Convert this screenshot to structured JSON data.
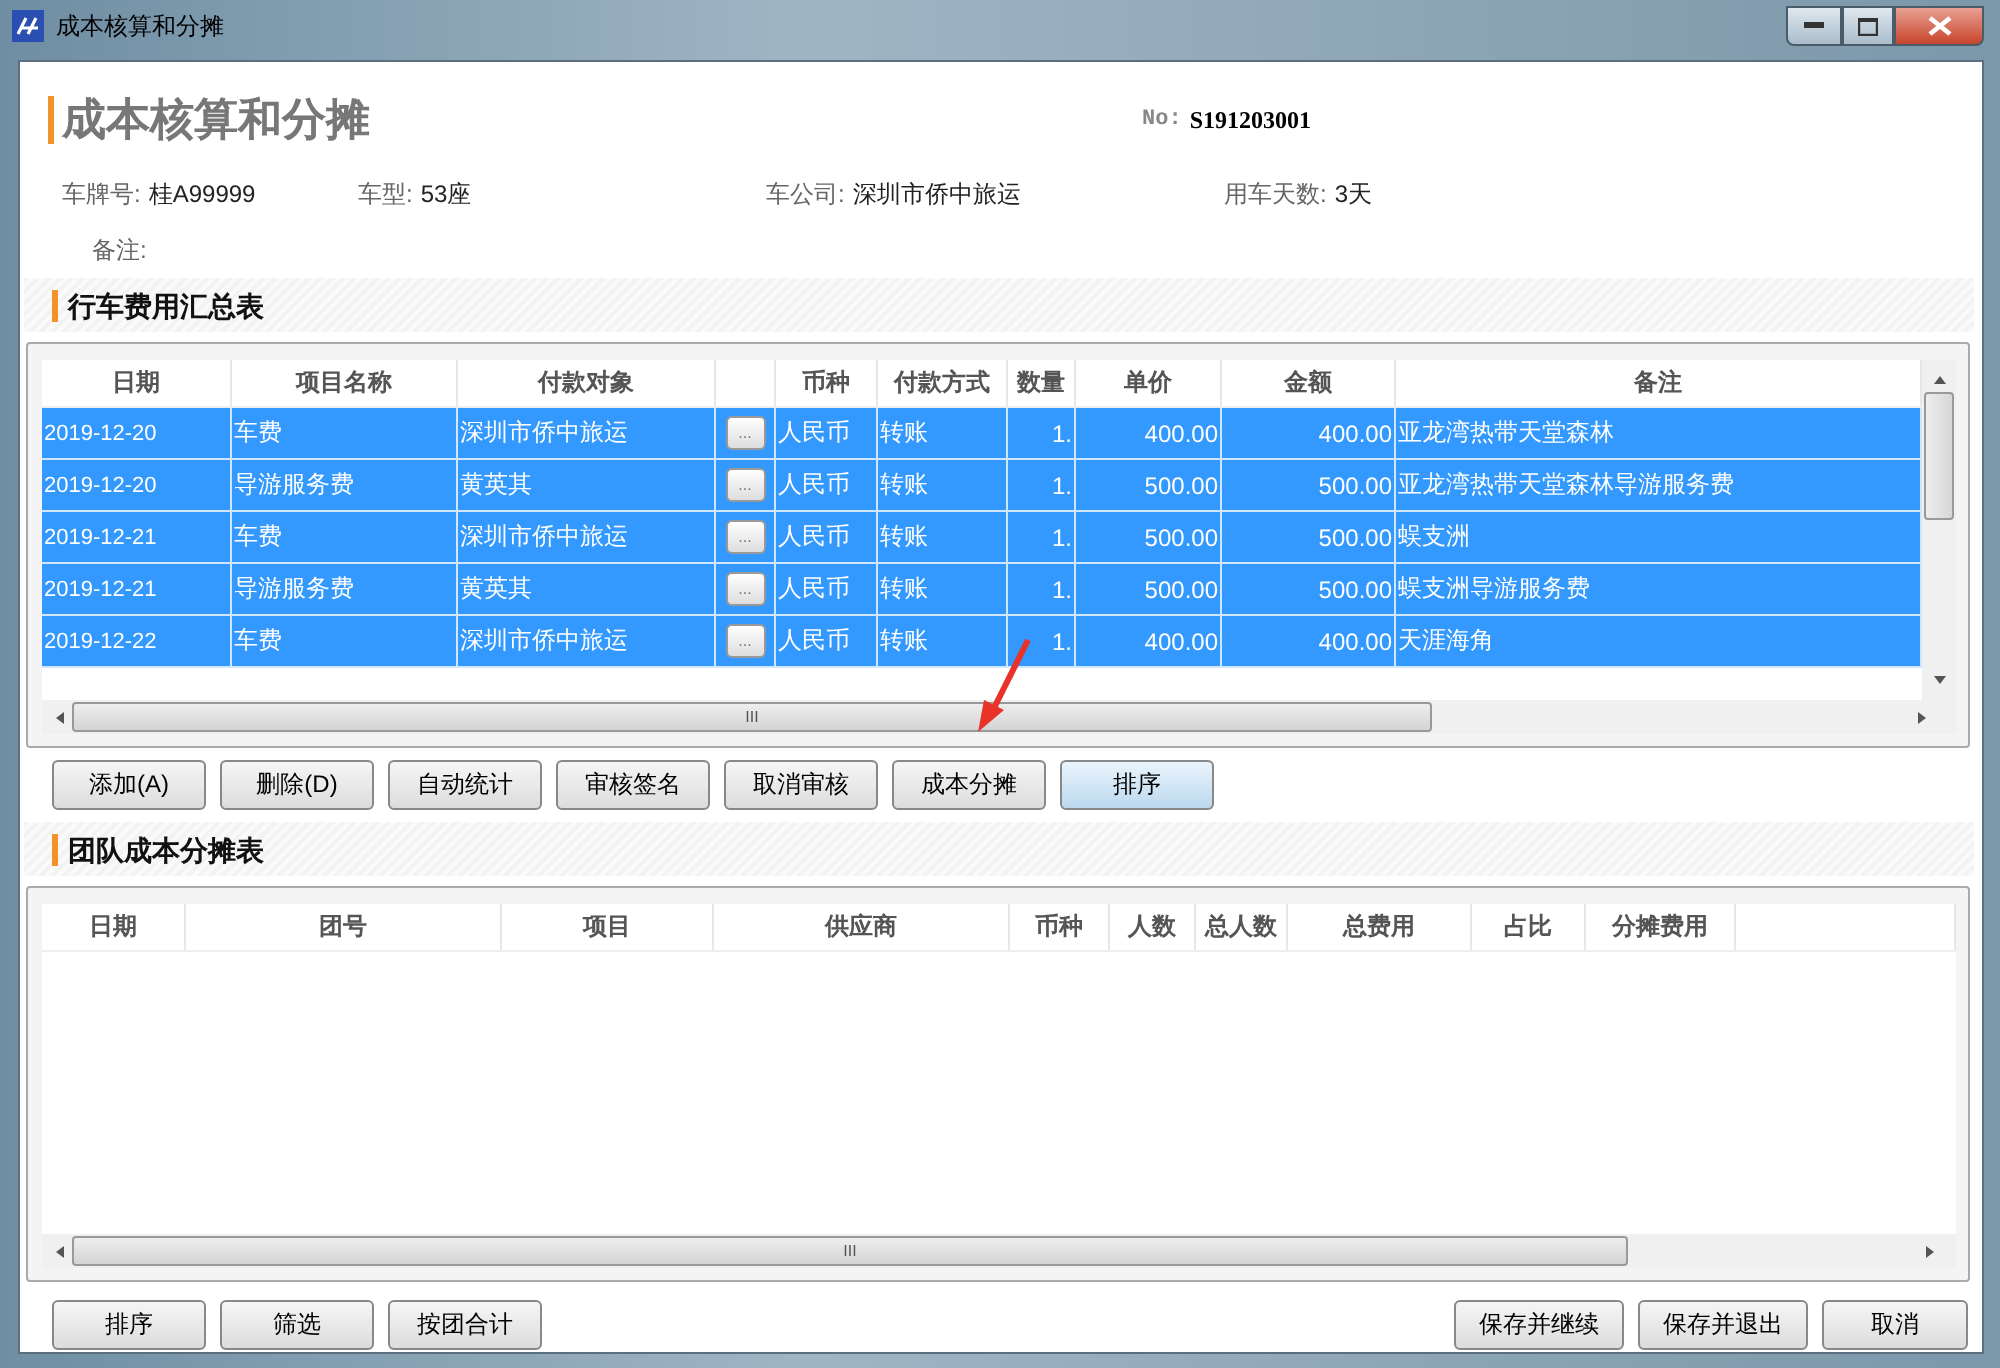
{
  "window": {
    "title": "成本核算和分摊"
  },
  "header": {
    "title": "成本核算和分摊",
    "number_label": "No:",
    "number": "S191203001"
  },
  "info": [
    {
      "label": "车牌号:",
      "value": "桂A99999"
    },
    {
      "label": "车型:",
      "value": "53座"
    },
    {
      "label": "车公司:",
      "value": "深圳市侨中旅运"
    },
    {
      "label": "用车天数:",
      "value": "3天"
    }
  ],
  "notes": {
    "label": "备注:"
  },
  "expense_section": {
    "title": "行车费用汇总表",
    "columns": [
      "日期",
      "项目名称",
      "付款对象",
      "",
      "币种",
      "付款方式",
      "数量",
      "单价",
      "金额",
      "备注"
    ],
    "rows": [
      {
        "selected": true,
        "cells": [
          "2019-12-20",
          "车费",
          "深圳市侨中旅运",
          "...",
          "人民币",
          "转账",
          "1.",
          "400.00",
          "400.00",
          "亚龙湾热带天堂森林"
        ]
      },
      {
        "selected": true,
        "cells": [
          "2019-12-20",
          "导游服务费",
          "黄英其",
          "...",
          "人民币",
          "转账",
          "1.",
          "500.00",
          "500.00",
          "亚龙湾热带天堂森林导游服务费"
        ]
      },
      {
        "selected": true,
        "cells": [
          "2019-12-21",
          "车费",
          "深圳市侨中旅运",
          "...",
          "人民币",
          "转账",
          "1.",
          "500.00",
          "500.00",
          "蜈支洲"
        ]
      },
      {
        "selected": true,
        "cells": [
          "2019-12-21",
          "导游服务费",
          "黄英其",
          "...",
          "人民币",
          "转账",
          "1.",
          "500.00",
          "500.00",
          "蜈支洲导游服务费"
        ]
      },
      {
        "selected": true,
        "cells": [
          "2019-12-22",
          "车费",
          "深圳市侨中旅运",
          "...",
          "人民币",
          "转账",
          "1.",
          "400.00",
          "400.00",
          "天涯海角"
        ]
      }
    ],
    "scroll_mark": "III",
    "buttons": [
      "添加(A)",
      "删除(D)",
      "自动统计",
      "审核签名",
      "取消审核",
      "成本分摊",
      "排序"
    ]
  },
  "allocation_section": {
    "title": "团队成本分摊表",
    "columns": [
      "日期",
      "团号",
      "项目",
      "供应商",
      "币种",
      "人数",
      "总人数",
      "总费用",
      "占比",
      "分摊费用"
    ],
    "scroll_mark": "III"
  },
  "footer": {
    "left_buttons": [
      "排序",
      "筛选",
      "按团合计"
    ],
    "right_buttons": [
      "保存并继续",
      "保存并退出",
      "取消"
    ]
  }
}
